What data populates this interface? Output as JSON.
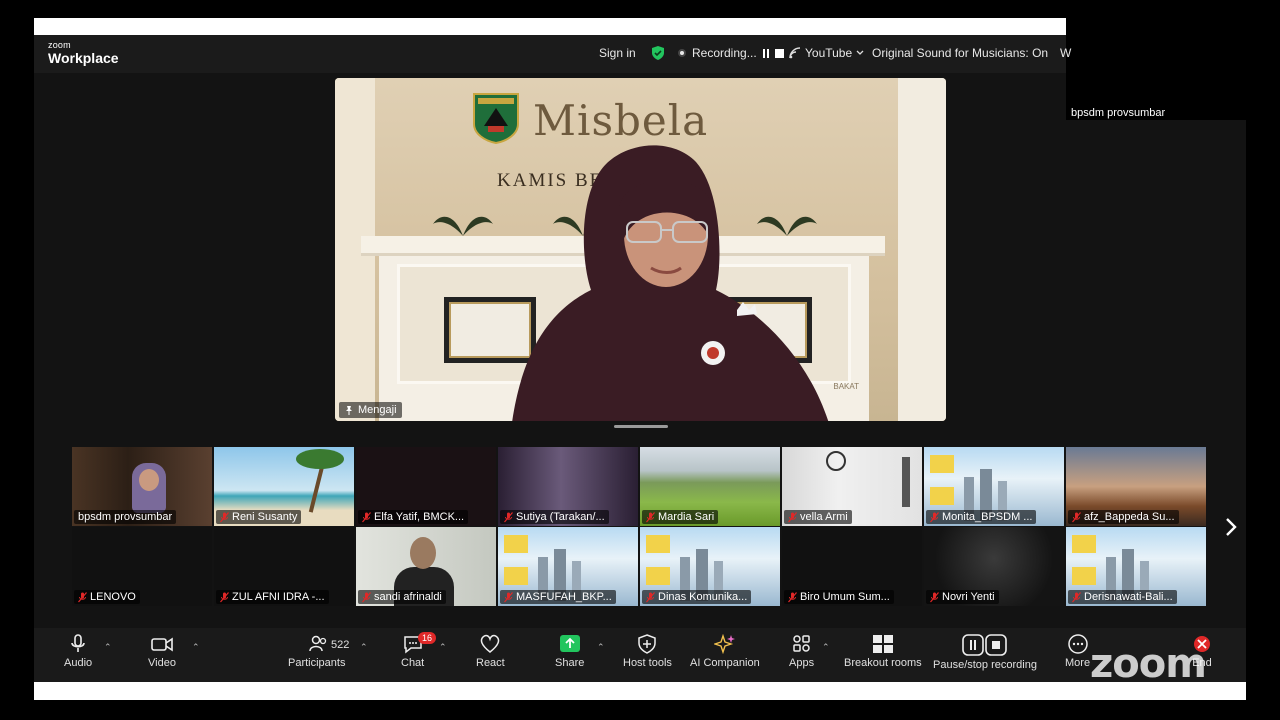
{
  "app": {
    "logo_small": "zoom",
    "logo_big": "Workplace"
  },
  "titlebar": {
    "sign_in": "Sign in",
    "recording": "Recording...",
    "youtube": "YouTube",
    "original_sound": "Original Sound for Musicians: On",
    "cut_text": "W"
  },
  "external_name": "bpsdm provsumbar",
  "speaker": {
    "label": "Mengaji",
    "brand": "Misbela",
    "subbrand": "KAMIS BE      RIES",
    "shelf_text": "BAKAT"
  },
  "gallery": {
    "tiles": [
      {
        "name": "bpsdm provsumbar",
        "bg": "#3a2a1e",
        "scene": "library",
        "muted": false
      },
      {
        "name": "Reni Susanty",
        "bg": "#7cb7d8",
        "scene": "beach",
        "muted": true
      },
      {
        "name": "Elfa Yatif, BMCK...",
        "bg": "#1a1114",
        "scene": "dark",
        "muted": true
      },
      {
        "name": "Sutiya (Tarakan/...",
        "bg": "#3b2c45",
        "scene": "purple",
        "muted": true
      },
      {
        "name": "Mardia Sari",
        "bg": "#7aa14a",
        "scene": "field",
        "muted": true
      },
      {
        "name": "vella Armi",
        "bg": "#e6e6e6",
        "scene": "room",
        "muted": true
      },
      {
        "name": "Monita_BPSDM ...",
        "bg": "#6aa6d8",
        "scene": "poster",
        "muted": true
      },
      {
        "name": "afz_Bappeda Su...",
        "bg": "#9a8a80",
        "scene": "sunset",
        "muted": true
      },
      {
        "name": "LENOVO",
        "bg": "#111111",
        "scene": "blank",
        "muted": true
      },
      {
        "name": "ZUL AFNI IDRA -...",
        "bg": "#111111",
        "scene": "blank",
        "muted": true
      },
      {
        "name": "sandi afrinaldi",
        "bg": "#c9ccc4",
        "scene": "man",
        "muted": true
      },
      {
        "name": "MASFUFAH_BKP...",
        "bg": "#8fb8dc",
        "scene": "poster",
        "muted": true
      },
      {
        "name": "Dinas Komunika...",
        "bg": "#8fb8dc",
        "scene": "poster",
        "muted": true
      },
      {
        "name": "Biro Umum Sum...",
        "bg": "#111111",
        "scene": "blank",
        "muted": true
      },
      {
        "name": "Novri Yenti",
        "bg": "#1c1c1c",
        "scene": "dim",
        "muted": true
      },
      {
        "name": "Derisnawati-Bali...",
        "bg": "#8fb8dc",
        "scene": "poster",
        "muted": true
      }
    ]
  },
  "toolbar": {
    "audio": "Audio",
    "video": "Video",
    "participants": "Participants",
    "participant_count": "522",
    "chat": "Chat",
    "chat_badge": "16",
    "react": "React",
    "share": "Share",
    "host_tools": "Host tools",
    "ai_companion": "AI Companion",
    "apps": "Apps",
    "breakout_rooms": "Breakout rooms",
    "pause_stop_recording": "Pause/stop recording",
    "more": "More",
    "end": "End"
  },
  "watermark": "zoom",
  "colors": {
    "share_green": "#22c55e",
    "badge_red": "#e02828",
    "muted_red": "#e02828"
  }
}
